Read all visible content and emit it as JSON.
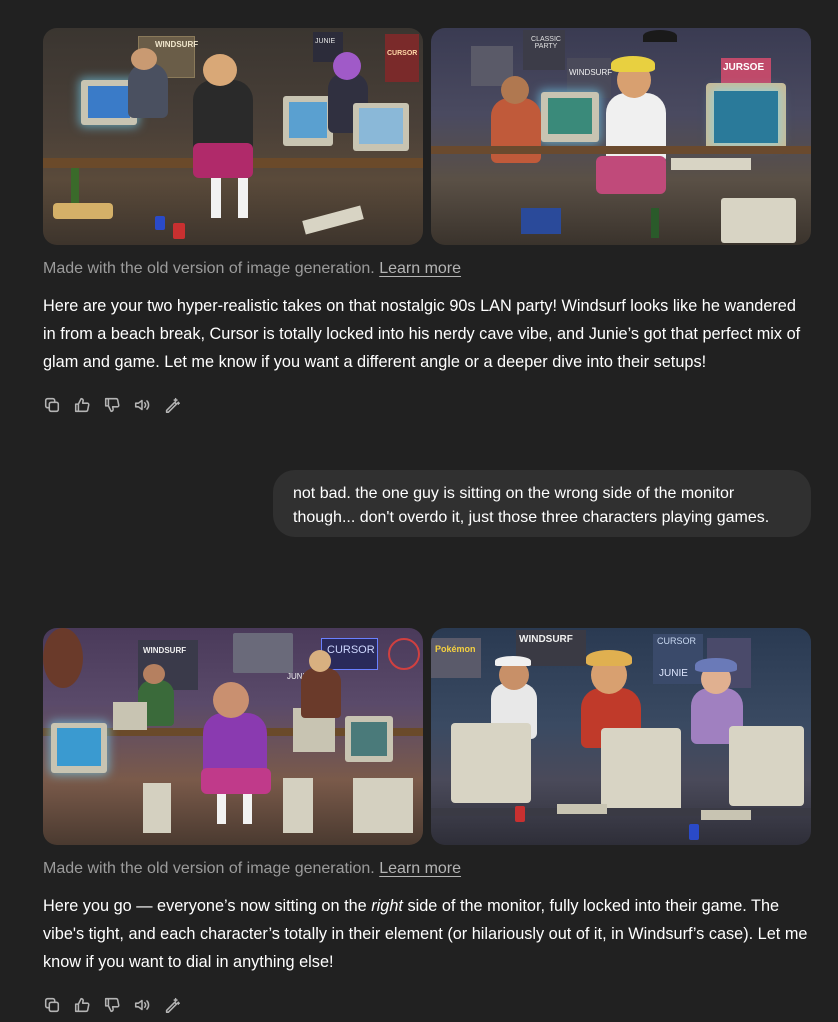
{
  "conversation": {
    "block1": {
      "images": [
        {
          "alt": "90s LAN party scene 1",
          "poster_labels": [
            "WINDSURF",
            "JUNIE",
            "CURSOR"
          ]
        },
        {
          "alt": "90s LAN party scene 2",
          "poster_labels": [
            "CLASSIC PARTY",
            "WINDSURF",
            "JURSOE"
          ]
        }
      ],
      "caption": "Made with the old version of image generation.",
      "learn_more": "Learn more",
      "text": "Here are your two hyper-realistic takes on that nostalgic 90s LAN party! Windsurf looks like he wandered in from a beach break, Cursor is totally locked into his nerdy cave vibe, and Junie’s got that perfect mix of glam and game. Let me know if you want a different angle or a deeper dive into their setups!"
    },
    "user_message": {
      "line1": "not bad. the one guy is sitting on the wrong side of the monitor",
      "line2": "though... don't overdo it, just those three characters playing games."
    },
    "block2": {
      "images": [
        {
          "alt": "90s LAN party scene 3",
          "poster_labels": [
            "WINDSURF",
            "CURSOR",
            "JUNIE"
          ]
        },
        {
          "alt": "90s LAN party scene 4",
          "poster_labels": [
            "Pokémon",
            "WINDSURF",
            "CURSOR",
            "JUNIE"
          ]
        }
      ],
      "caption": "Made with the old version of image generation.",
      "learn_more": "Learn more",
      "text_part1": "Here you go — everyone’s now sitting on the ",
      "text_italic": "right",
      "text_part2": " side of the monitor, fully locked into their game. The vibe's tight, and each character’s totally in their element (or hilariously out of it, in Windsurf’s case). Let me know if you want to dial in anything else!"
    },
    "action_icons": [
      "copy-icon",
      "thumbs-up-icon",
      "thumbs-down-icon",
      "read-aloud-icon",
      "edit-image-icon"
    ]
  },
  "colors": {
    "background": "#212121",
    "bubble": "#303030",
    "muted_text": "#9b9b9b"
  }
}
